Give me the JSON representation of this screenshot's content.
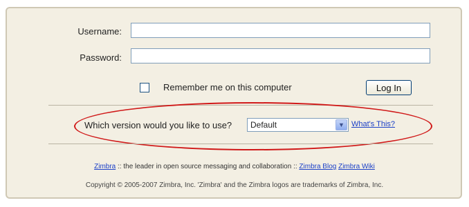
{
  "login": {
    "username_label": "Username:",
    "username_value": "",
    "password_label": "Password:",
    "password_value": "",
    "remember_label": "Remember me on this computer",
    "remember_checked": false,
    "login_button": "Log In"
  },
  "version": {
    "question": "Which version would you like to use?",
    "selected": "Default",
    "whats_this": "What's This?"
  },
  "footer": {
    "zimbra_link": "Zimbra",
    "tagline": " :: the leader in open source messaging and collaboration :: ",
    "blog_link": "Zimbra Blog",
    "wiki_link": "Zimbra Wiki",
    "copyright": "Copyright © 2005-2007 Zimbra, Inc. 'Zimbra' and the Zimbra logos are trademarks of Zimbra, Inc."
  },
  "colors": {
    "panel_bg": "#f3efe3",
    "highlight_oval": "#d01818",
    "link": "#1a3fc7"
  }
}
